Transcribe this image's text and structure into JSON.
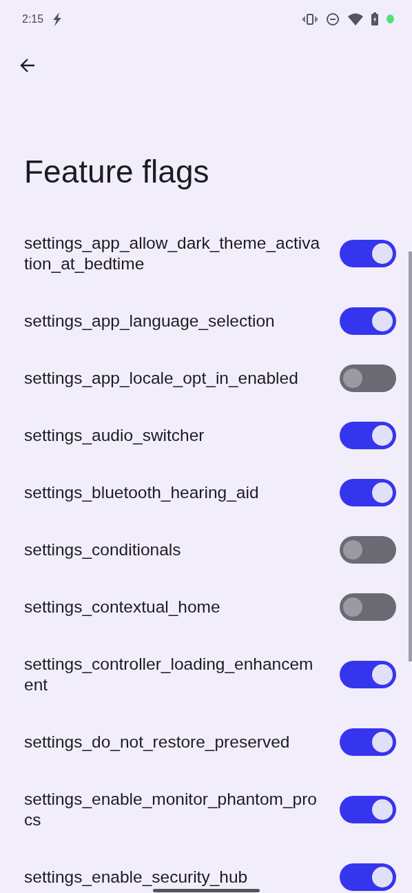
{
  "status_bar": {
    "time": "2:15"
  },
  "title": "Feature flags",
  "flags": [
    {
      "name": "settings_app_allow_dark_theme_activation_at_bedtime",
      "on": true
    },
    {
      "name": "settings_app_language_selection",
      "on": true
    },
    {
      "name": "settings_app_locale_opt_in_enabled",
      "on": false
    },
    {
      "name": "settings_audio_switcher",
      "on": true
    },
    {
      "name": "settings_bluetooth_hearing_aid",
      "on": true
    },
    {
      "name": "settings_conditionals",
      "on": false
    },
    {
      "name": "settings_contextual_home",
      "on": false
    },
    {
      "name": "settings_controller_loading_enhancement",
      "on": true
    },
    {
      "name": "settings_do_not_restore_preserved",
      "on": true
    },
    {
      "name": "settings_enable_monitor_phantom_procs",
      "on": true
    },
    {
      "name": "settings_enable_security_hub",
      "on": true
    }
  ]
}
